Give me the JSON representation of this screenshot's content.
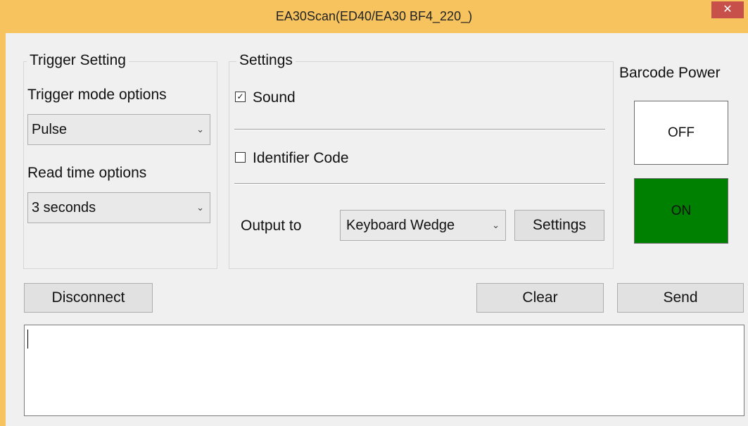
{
  "window": {
    "title": "EA30Scan(ED40/EA30 BF4_220_)",
    "close_label": "✕",
    "title_bar_color": "#f6c35e"
  },
  "trigger_group": {
    "legend": "Trigger Setting",
    "trigger_mode_label": "Trigger mode options",
    "trigger_mode_value": "Pulse",
    "read_time_label": "Read time options",
    "read_time_value": "3 seconds"
  },
  "settings_group": {
    "legend": "Settings",
    "sound_label": "Sound",
    "sound_checked": true,
    "identifier_label": "Identifier Code",
    "identifier_checked": false,
    "output_label": "Output to",
    "output_value": "Keyboard Wedge",
    "settings_button": "Settings"
  },
  "barcode_power": {
    "label": "Barcode Power",
    "off_label": "OFF",
    "on_label": "ON",
    "on_color": "#008000"
  },
  "actions": {
    "disconnect": "Disconnect",
    "clear": "Clear",
    "send": "Send"
  },
  "output_text": "",
  "icons": {
    "dropdown_arrow": "⌄",
    "check_mark": "✓"
  }
}
